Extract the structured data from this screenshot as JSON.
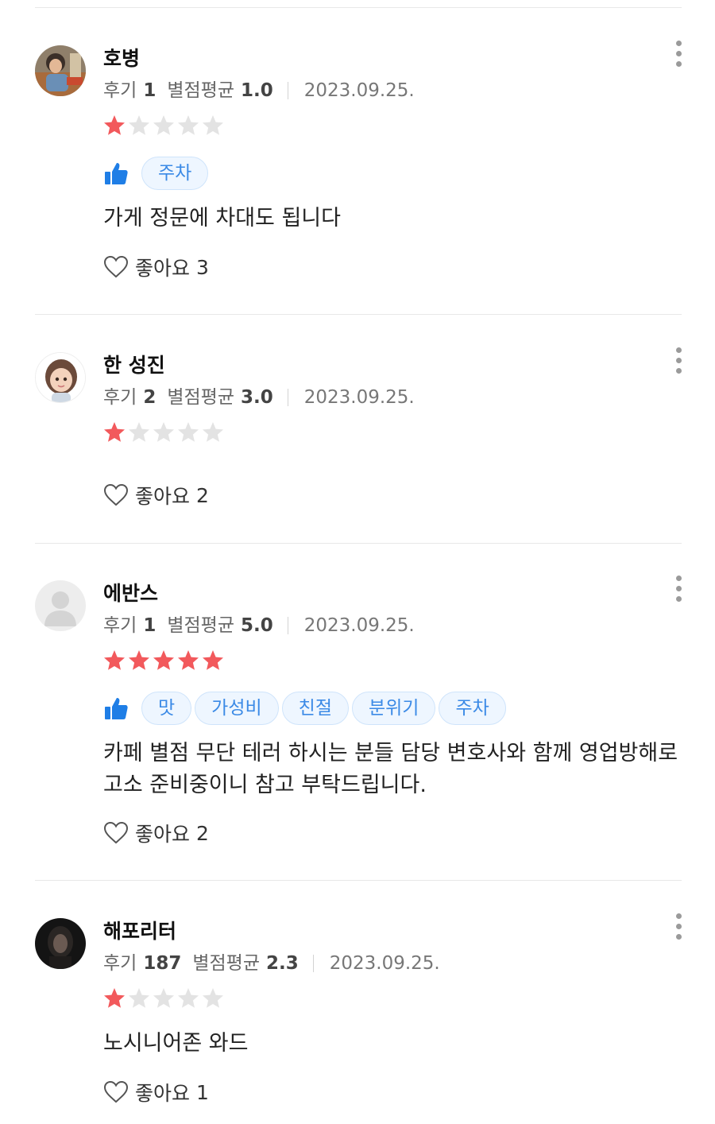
{
  "reviews": [
    {
      "name": "호병",
      "review_count_label": "후기",
      "review_count": "1",
      "avg_label": "별점평균",
      "avg": "1.0",
      "date": "2023.09.25.",
      "rating": 1,
      "tags": [
        "주차"
      ],
      "body": "가게 정문에 차대도 됩니다",
      "like_label": "좋아요",
      "likes": "3"
    },
    {
      "name": "한 성진",
      "review_count_label": "후기",
      "review_count": "2",
      "avg_label": "별점평균",
      "avg": "3.0",
      "date": "2023.09.25.",
      "rating": 1,
      "tags": [],
      "body": "",
      "like_label": "좋아요",
      "likes": "2"
    },
    {
      "name": "에반스",
      "review_count_label": "후기",
      "review_count": "1",
      "avg_label": "별점평균",
      "avg": "5.0",
      "date": "2023.09.25.",
      "rating": 5,
      "tags": [
        "맛",
        "가성비",
        "친절",
        "분위기",
        "주차"
      ],
      "body": "카페 별점 무단 테러 하시는 분들 담당 변호사와 함께 영업방해로 고소 준비중이니 참고 부탁드립니다.",
      "like_label": "좋아요",
      "likes": "2"
    },
    {
      "name": "해포리터",
      "review_count_label": "후기",
      "review_count": "187",
      "avg_label": "별점평균",
      "avg": "2.3",
      "date": "2023.09.25.",
      "rating": 1,
      "tags": [],
      "body": "노시니어존 와드",
      "like_label": "좋아요",
      "likes": "1"
    }
  ],
  "colors": {
    "star_on": "#f2595c",
    "star_off": "#e3e3e3",
    "tag_text": "#3b8ae6",
    "thumb": "#1f7ee6"
  },
  "icons": {
    "avatar": "avatar-icon",
    "more": "more-vertical-icon",
    "star": "star-icon",
    "thumb": "thumbs-up-icon",
    "heart": "heart-outline-icon"
  }
}
